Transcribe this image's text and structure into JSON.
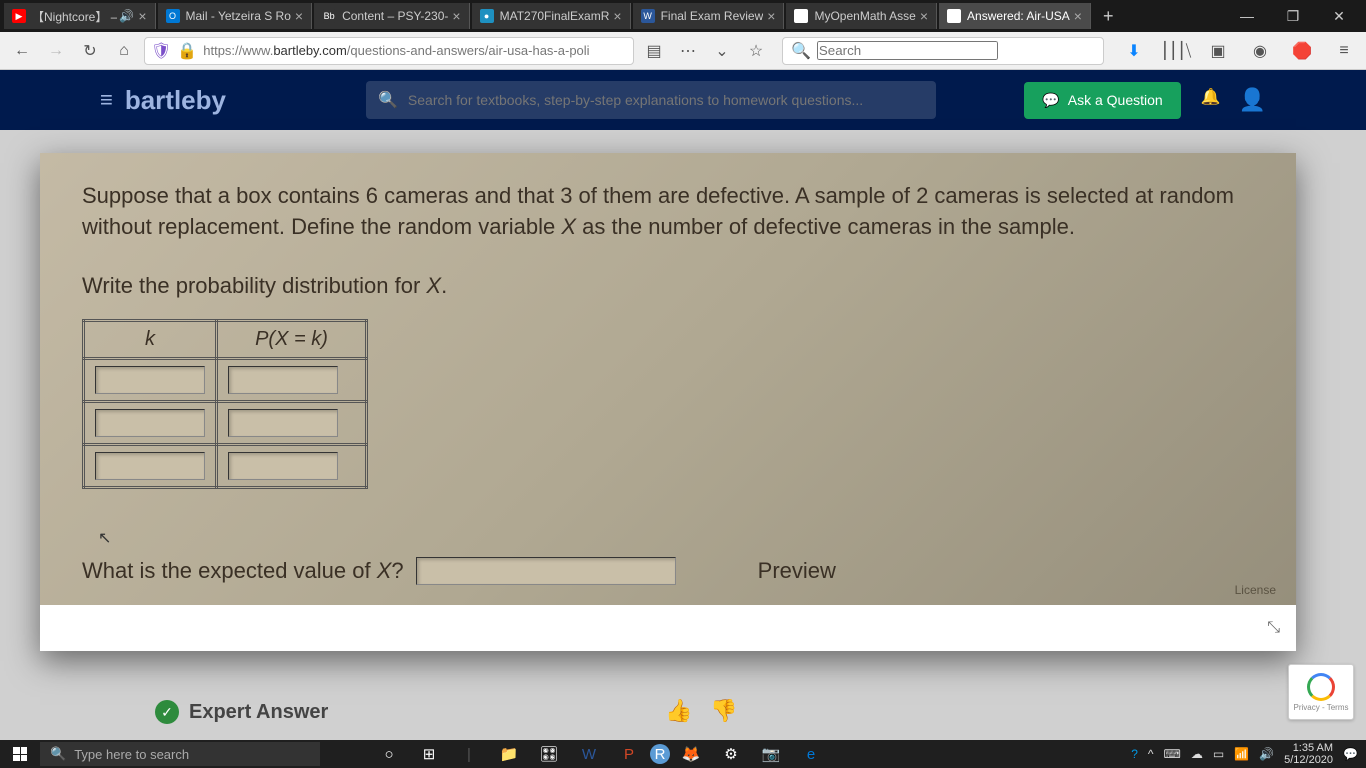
{
  "tabs": [
    {
      "icon_bg": "#ff0000",
      "icon_text": "▶",
      "title": "【Nightcore】 –",
      "audio": true
    },
    {
      "icon_bg": "#0078d4",
      "icon_text": "O",
      "title": "Mail - Yetzeira S Ro"
    },
    {
      "icon_bg": "#333",
      "icon_text": "Bb",
      "title": "Content – PSY-230-"
    },
    {
      "icon_bg": "#1e90c0",
      "icon_text": "●",
      "title": "MAT270FinalExamR"
    },
    {
      "icon_bg": "#2b579a",
      "icon_text": "W",
      "title": "Final Exam Review"
    },
    {
      "icon_bg": "#fff",
      "icon_text": "M",
      "title": "MyOpenMath Asse"
    },
    {
      "icon_bg": "#fff",
      "icon_text": "b",
      "title": "Answered: Air-USA",
      "active": true
    }
  ],
  "url": {
    "prefix": "https://www.",
    "domain": "bartleby.com",
    "path": "/questions-and-answers/air-usa-has-a-poli"
  },
  "searchPlaceholder": "Search",
  "brand": "bartleby",
  "bartlebySearchPlaceholder": "Search for textbooks, step-by-step explanations to homework questions...",
  "askButton": "Ask a Question",
  "question": {
    "line1": "Suppose that a box contains 6 cameras and that 3 of them are defective. A sample of 2 cameras is selected at random without replacement. Define the random variable ",
    "var": "X",
    "line1b": " as the number of defective cameras in the sample.",
    "line2": "Write the probability distribution for ",
    "th_k": "k",
    "th_pk": "P(X = k)",
    "expected": "What is the expected value of ",
    "preview": "Preview",
    "license": "License"
  },
  "expertAnswer": "Expert Answer",
  "recaptcha": "Privacy - Terms",
  "taskSearch": "Type here to search",
  "clock": {
    "time": "1:35 AM",
    "date": "5/12/2020"
  }
}
